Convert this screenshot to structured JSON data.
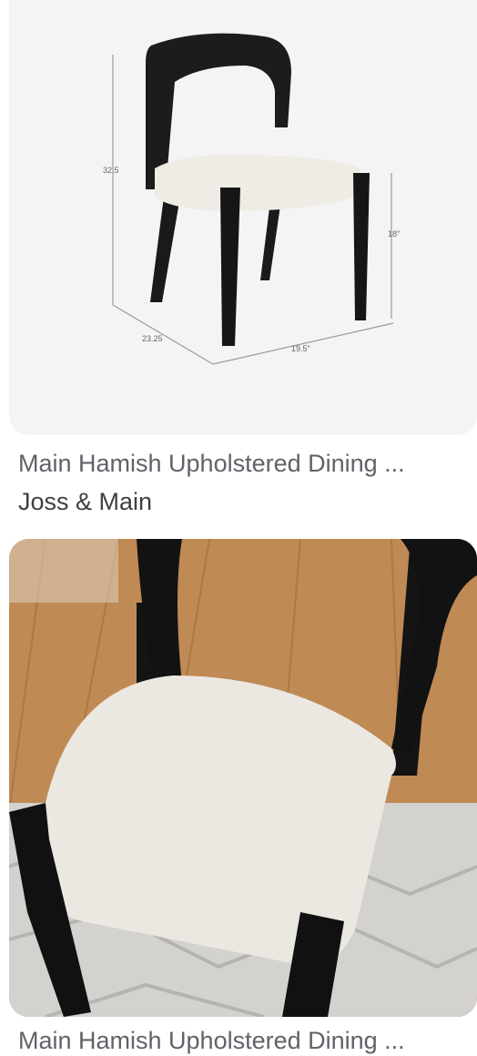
{
  "results": [
    {
      "title": "Main Hamish Upholstered Dining ...",
      "source": "Joss & Main",
      "image": {
        "kind": "product-photo-dimensions",
        "dimension_labels": [
          "32.5",
          "18\"",
          "23.25",
          "19.5\""
        ]
      }
    },
    {
      "title": "Main Hamish Upholstered Dining ...",
      "image": {
        "kind": "product-photo-room"
      }
    }
  ]
}
